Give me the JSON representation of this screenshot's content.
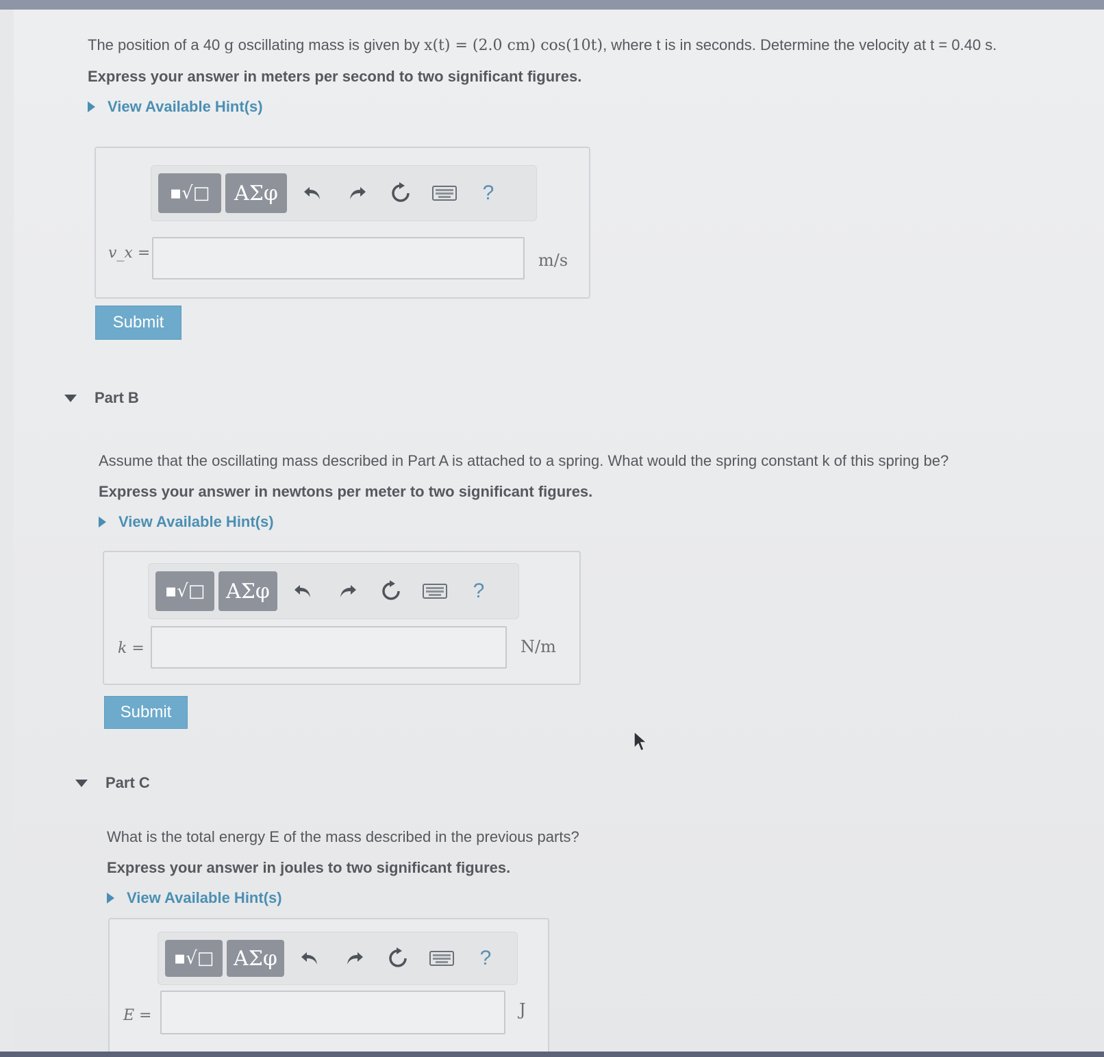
{
  "part_a": {
    "question_prefix": "The position of a 40",
    "mass_unit": "g",
    "question_mid": "oscillating mass is given by",
    "equation": "x(t) = (2.0 cm) cos(10t)",
    "question_suffix": ", where t is in seconds. Determine the velocity at t = 0.40 s.",
    "instruction": "Express your answer in meters per second to two significant figures.",
    "hint_label": "View Available Hint(s)",
    "variable_label": "v_x =",
    "input_value": "",
    "unit": "m/s",
    "submit_label": "Submit"
  },
  "part_b": {
    "header": "Part B",
    "question": "Assume that the oscillating mass described in Part A is attached to a spring. What would the spring constant k of this spring be?",
    "instruction": "Express your answer in newtons per meter to two significant figures.",
    "hint_label": "View Available Hint(s)",
    "variable_label": "k =",
    "input_value": "",
    "unit": "N/m",
    "submit_label": "Submit"
  },
  "part_c": {
    "header": "Part C",
    "question": "What is the total energy E of the mass described in the previous parts?",
    "instruction": "Express your answer in joules to two significant figures.",
    "hint_label": "View Available Hint(s)",
    "variable_label": "E =",
    "input_value": "",
    "unit": "J"
  },
  "toolbar": {
    "templates_icon": "templates-sqrt-icon",
    "greek_label": "ΑΣφ",
    "undo_icon": "undo-icon",
    "redo_icon": "redo-icon",
    "reset_icon": "reset-icon",
    "keyboard_icon": "keyboard-icon",
    "help_label": "?"
  },
  "colors": {
    "accent": "#4a8fb3",
    "submit_bg": "#6eaacb",
    "toolbar_button": "#8d929b"
  }
}
